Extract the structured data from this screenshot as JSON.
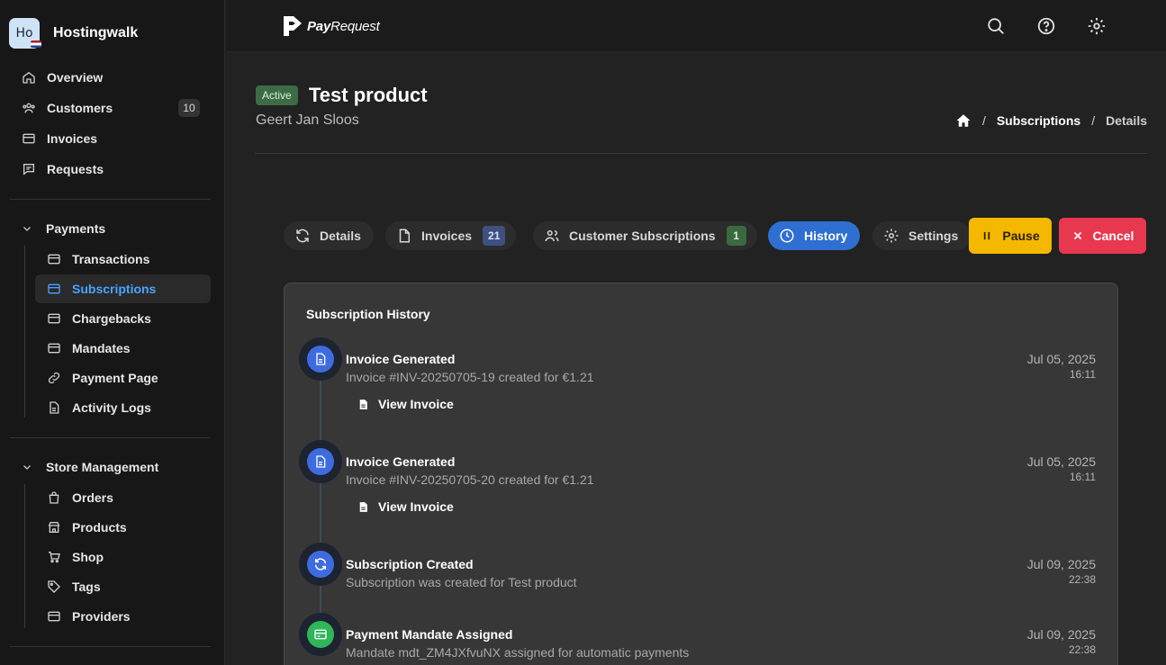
{
  "brand": {
    "initials": "Ho",
    "name": "Hostingwalk"
  },
  "sidebar": {
    "main": [
      {
        "label": "Overview"
      },
      {
        "label": "Customers",
        "count": "10"
      },
      {
        "label": "Invoices"
      },
      {
        "label": "Requests"
      }
    ],
    "payments": {
      "heading": "Payments",
      "items": [
        {
          "label": "Transactions"
        },
        {
          "label": "Subscriptions"
        },
        {
          "label": "Chargebacks"
        },
        {
          "label": "Mandates"
        },
        {
          "label": "Payment Page"
        },
        {
          "label": "Activity Logs"
        }
      ]
    },
    "store": {
      "heading": "Store Management",
      "items": [
        {
          "label": "Orders"
        },
        {
          "label": "Products"
        },
        {
          "label": "Shop"
        },
        {
          "label": "Tags"
        },
        {
          "label": "Providers"
        }
      ]
    }
  },
  "topbar": {
    "logo_bold": "Pay",
    "logo_rest": "Request"
  },
  "header": {
    "status": "Active",
    "title": "Test product",
    "subtitle": "Geert Jan Sloos",
    "breadcrumb": [
      "Subscriptions",
      "Details"
    ],
    "breadcrumb_sep": "/"
  },
  "tabs": [
    {
      "label": "Details"
    },
    {
      "label": "Invoices",
      "badge": "21"
    },
    {
      "label": "Customer Subscriptions",
      "badge": "1"
    },
    {
      "label": "History"
    },
    {
      "label": "Settings"
    }
  ],
  "actions": {
    "pause": "Pause",
    "cancel": "Cancel"
  },
  "history": {
    "title": "Subscription History",
    "events": [
      {
        "title": "Invoice Generated",
        "desc": "Invoice #INV-20250705-19 created for €1.21",
        "date": "Jul 05, 2025",
        "time": "16:11",
        "link": "View Invoice",
        "icon": "document-icon"
      },
      {
        "title": "Invoice Generated",
        "desc": "Invoice #INV-20250705-20 created for €1.21",
        "date": "Jul 05, 2025",
        "time": "16:11",
        "link": "View Invoice",
        "icon": "document-icon"
      },
      {
        "title": "Subscription Created",
        "desc": "Subscription was created for Test product",
        "date": "Jul 09, 2025",
        "time": "22:38",
        "icon": "refresh-icon"
      },
      {
        "title": "Payment Mandate Assigned",
        "desc": "Mandate mdt_ZM4JXfvuNX assigned for automatic payments",
        "date": "Jul 09, 2025",
        "time": "22:38",
        "icon": "card-icon"
      }
    ]
  },
  "colors": {
    "accent": "#2f6fd1",
    "active_nav": "#4aa3ff",
    "status_active": "#3d6b45",
    "pause": "#f5b800",
    "cancel": "#e8384f",
    "icon_blue": "#3e6be0",
    "icon_green": "#2fb55a"
  }
}
